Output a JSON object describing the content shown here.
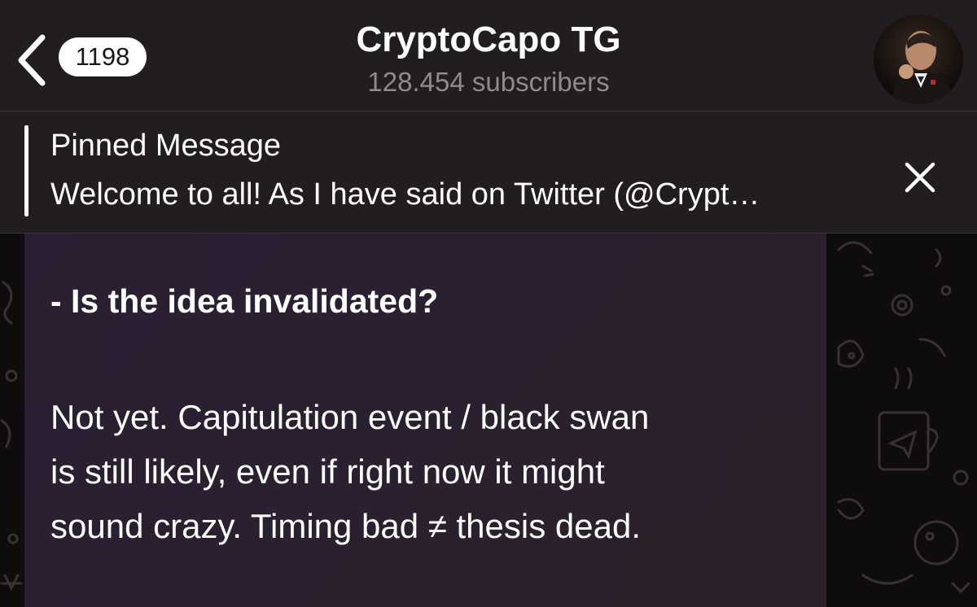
{
  "header": {
    "unread_count": "1198",
    "channel_title": "CryptoCapo TG",
    "subscribers": "128.454 subscribers"
  },
  "pinned": {
    "title": "Pinned Message",
    "preview": "Welcome to all! As I have said on Twitter (@Crypt…"
  },
  "message": {
    "heading": "- Is the idea invalidated?",
    "body_lines": [
      "Not yet. Capitulation event / black swan",
      "is still likely, even if right now it might",
      "sound crazy. Timing bad ≠ thesis dead."
    ]
  },
  "icons": {
    "back": "chevron-left-icon",
    "close": "close-icon"
  },
  "colors": {
    "header_bg": "#221d20",
    "bubble_bg": "#2b1f33",
    "badge_bg": "#ffffff",
    "muted_text": "#8f8a8d"
  }
}
